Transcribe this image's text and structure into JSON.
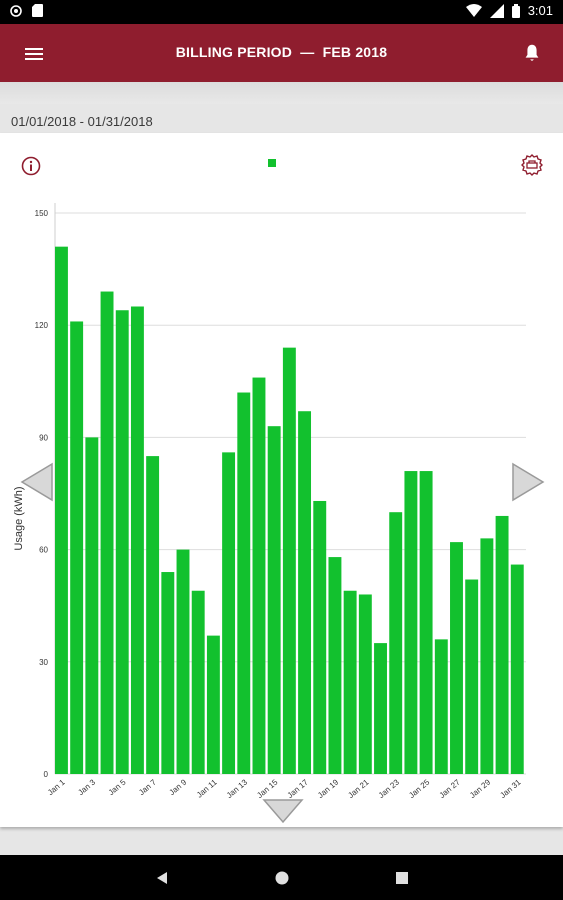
{
  "status_bar": {
    "time": "3:01"
  },
  "app_bar": {
    "title": "BILLING PERIOD  —  FEB 2018"
  },
  "date_range": "01/01/2018 - 01/31/2018",
  "colors": {
    "brand": "#8f1d2e",
    "bar": "#12c12e",
    "grid": "#dddddd"
  },
  "icons": {
    "menu": "hamburger-menu-icon",
    "notifications": "bell-icon",
    "info": "info-icon",
    "export": "export-icon",
    "prev": "chevron-left-icon",
    "next": "chevron-right-icon",
    "expand": "chevron-down-icon"
  },
  "chart_data": {
    "type": "bar",
    "ylabel": "Usage (kWh)",
    "xlabel": "",
    "ylim": [
      0,
      150
    ],
    "yticks": [
      0,
      30,
      60,
      90,
      120,
      150
    ],
    "grid": true,
    "legend": "top-center",
    "categories": [
      "Jan 1",
      "Jan 2",
      "Jan 3",
      "Jan 4",
      "Jan 5",
      "Jan 6",
      "Jan 7",
      "Jan 8",
      "Jan 9",
      "Jan 10",
      "Jan 11",
      "Jan 12",
      "Jan 13",
      "Jan 14",
      "Jan 15",
      "Jan 16",
      "Jan 17",
      "Jan 18",
      "Jan 19",
      "Jan 20",
      "Jan 21",
      "Jan 22",
      "Jan 23",
      "Jan 24",
      "Jan 25",
      "Jan 26",
      "Jan 27",
      "Jan 28",
      "Jan 29",
      "Jan 30",
      "Jan 31"
    ],
    "tick_labels": [
      "Jan 1",
      "Jan 3",
      "Jan 5",
      "Jan 7",
      "Jan 9",
      "Jan 11",
      "Jan 13",
      "Jan 15",
      "Jan 17",
      "Jan 19",
      "Jan 21",
      "Jan 23",
      "Jan 25",
      "Jan 27",
      "Jan 29",
      "Jan 31"
    ],
    "values": [
      141,
      121,
      90,
      129,
      124,
      125,
      85,
      54,
      60,
      49,
      37,
      86,
      102,
      106,
      93,
      114,
      97,
      73,
      58,
      49,
      48,
      35,
      70,
      81,
      81,
      36,
      62,
      52,
      63,
      69,
      56
    ]
  }
}
